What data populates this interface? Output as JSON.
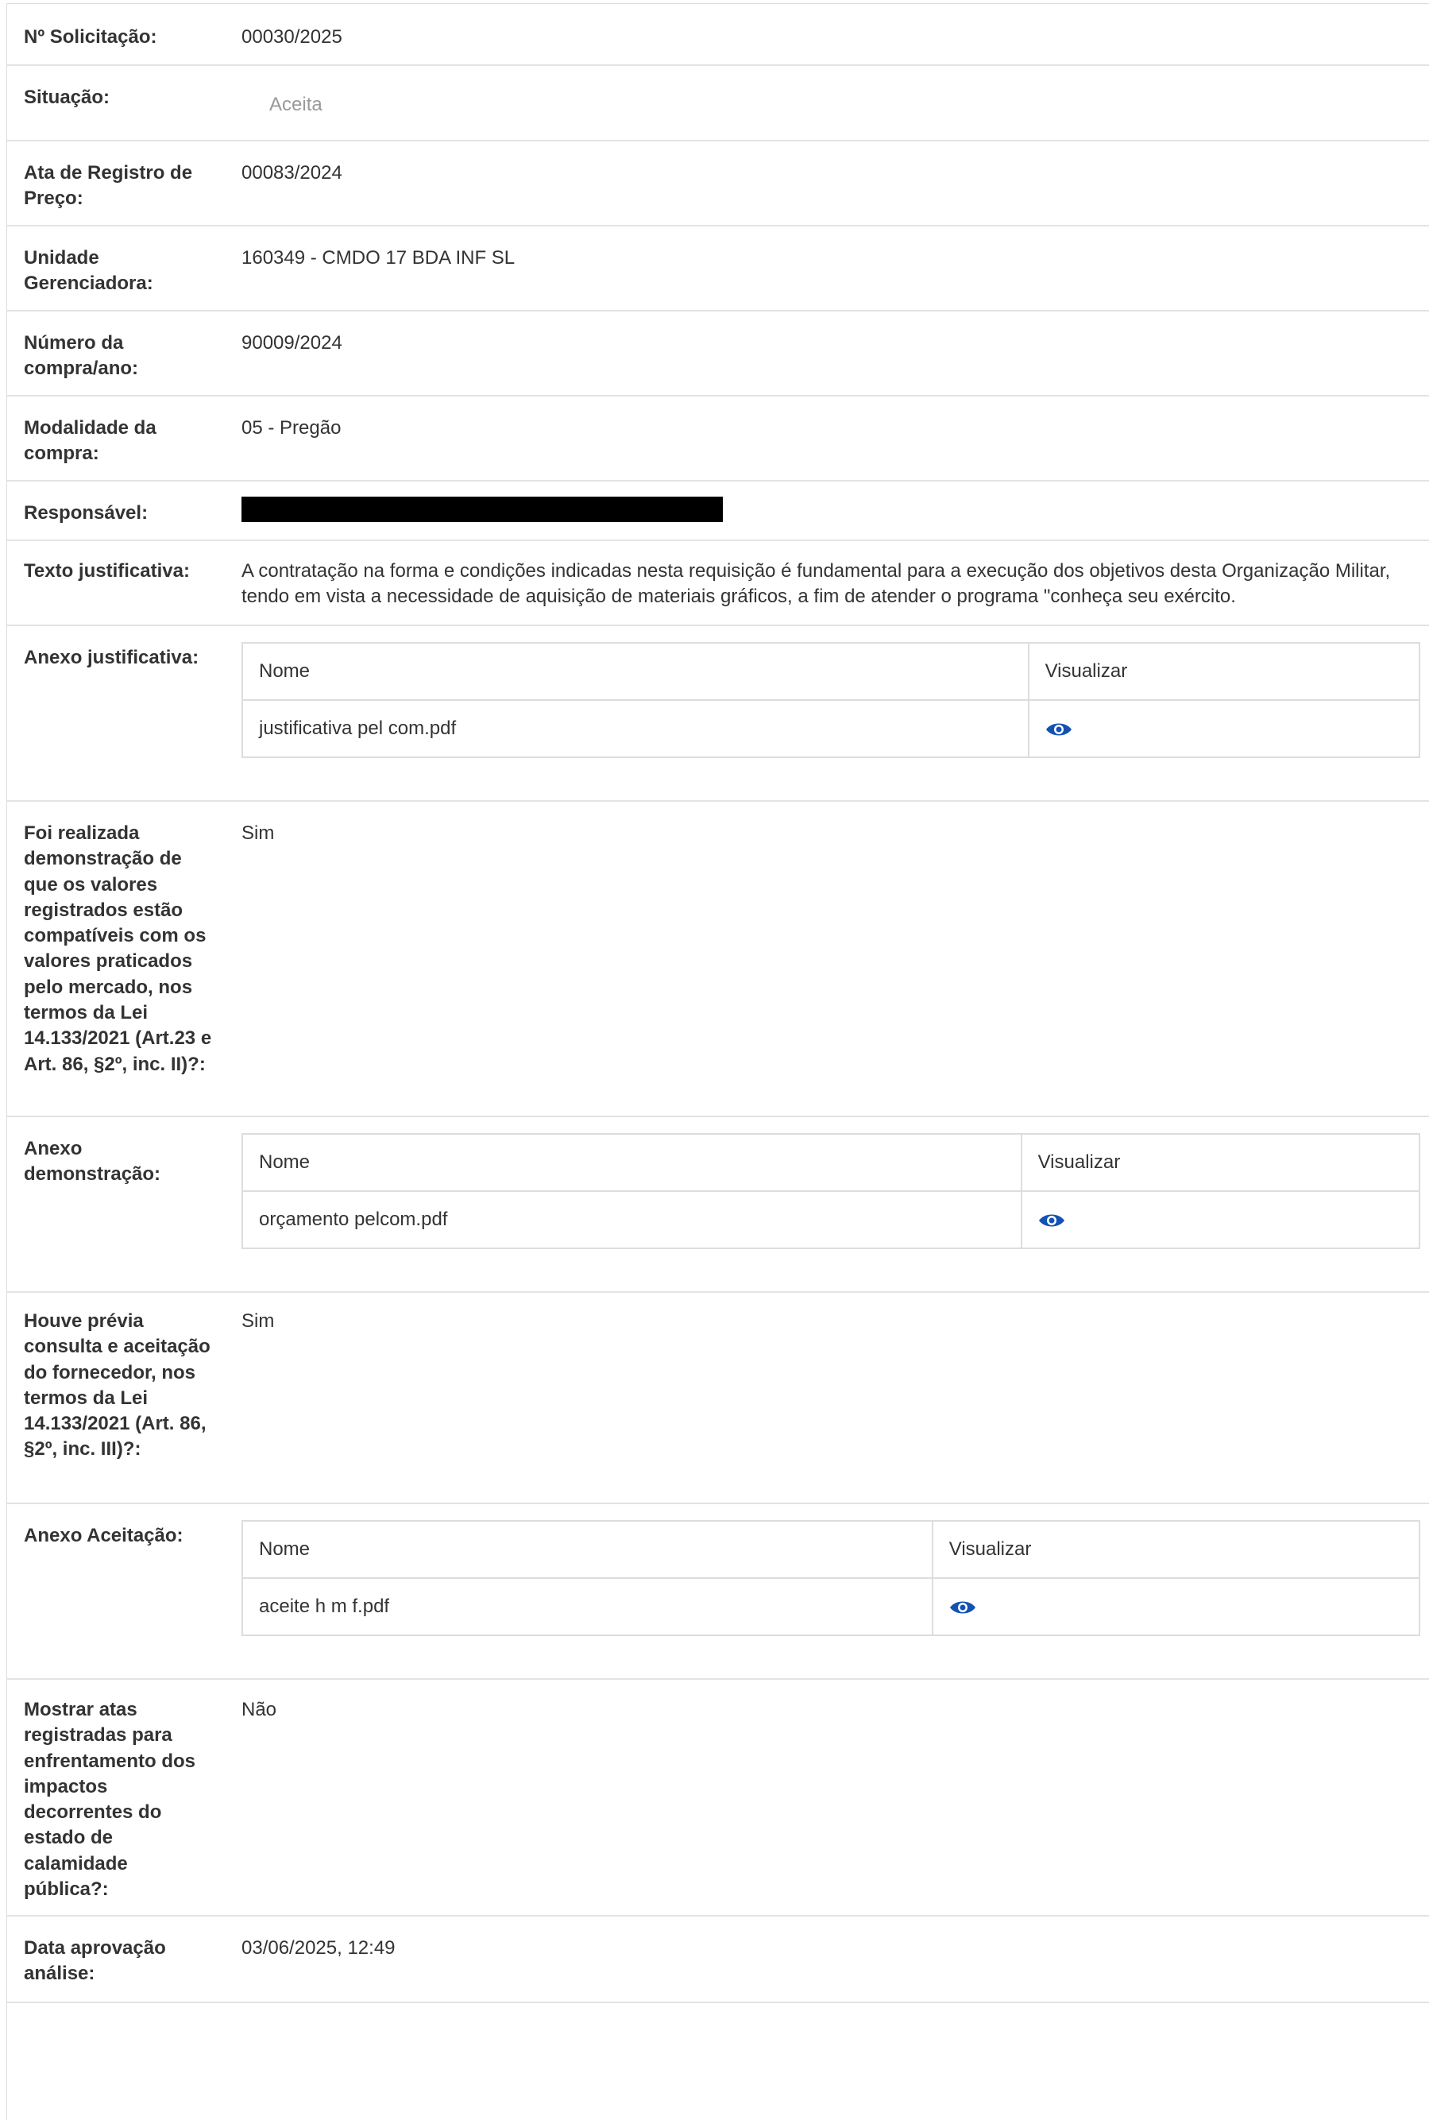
{
  "fields": {
    "solicitacao": {
      "label": "Nº Solicitação:",
      "value": "00030/2025"
    },
    "situacao": {
      "label": "Situação:",
      "value": "Aceita"
    },
    "ata": {
      "label": "Ata de Registro de Preço:",
      "value": "00083/2024"
    },
    "unidade": {
      "label": "Unidade Gerenciadora:",
      "value": "160349 - CMDO 17 BDA INF SL"
    },
    "numero_compra": {
      "label": "Número da compra/ano:",
      "value": "90009/2024"
    },
    "modalidade": {
      "label": "Modalidade da compra:",
      "value": "05 - Pregão"
    },
    "responsavel": {
      "label": "Responsável:"
    },
    "texto_justificativa": {
      "label": "Texto justificativa:",
      "value": "A contratação na forma e condições indicadas nesta requisição é fundamental para a execução dos objetivos desta Organização Militar, tendo em vista a necessidade de aquisição de materiais gráficos, a fim de atender o programa \"conheça seu exército."
    },
    "anexo_justificativa": {
      "label": "Anexo justificativa:"
    },
    "demonstracao": {
      "label": "Foi realizada demonstração de que os valores registrados estão compatíveis com os valores praticados pelo mercado, nos termos da Lei 14.133/2021 (Art.23 e Art. 86, §2º, inc. II)?:",
      "value": "Sim"
    },
    "anexo_demonstracao": {
      "label": "Anexo demonstração:"
    },
    "consulta_fornecedor": {
      "label": "Houve prévia consulta e aceitação do fornecedor, nos termos da Lei 14.133/2021 (Art. 86, §2º, inc. III)?:",
      "value": "Sim"
    },
    "anexo_aceitacao": {
      "label": "Anexo Aceitação:"
    },
    "calamidade": {
      "label": "Mostrar atas registradas para enfrentamento dos impactos decorrentes do estado de calamidade pública?:",
      "value": "Não"
    },
    "data_aprovacao": {
      "label": "Data aprovação análise:",
      "value": "03/06/2025, 12:49"
    }
  },
  "attachments_header": {
    "name": "Nome",
    "view": "Visualizar"
  },
  "attachments": {
    "justificativa": {
      "file": "justificativa pel com.pdf",
      "icon": "eye-icon"
    },
    "demonstracao": {
      "file": "orçamento pelcom.pdf",
      "icon": "eye-icon"
    },
    "aceitacao": {
      "file": "aceite h m f.pdf",
      "icon": "eye-icon"
    }
  },
  "colors": {
    "icon": "#1351b4",
    "status": "#999999",
    "border": "#dddddd"
  }
}
